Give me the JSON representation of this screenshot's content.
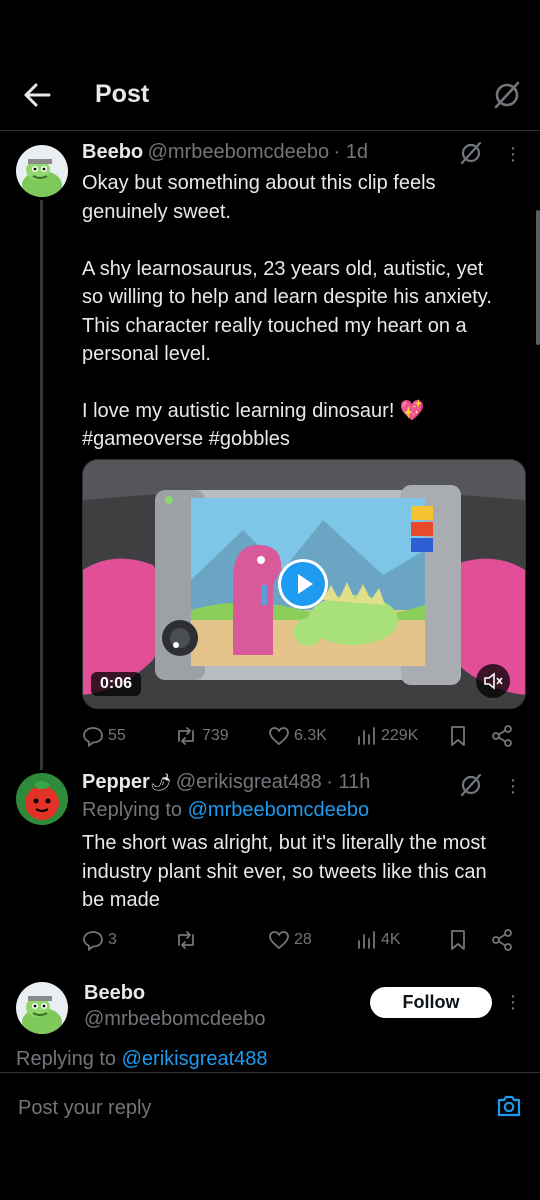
{
  "header": {
    "title": "Post"
  },
  "main_post": {
    "name": "Beebo",
    "handle": "@mrbeebomcdeebo",
    "time": "· 1d",
    "body": "Okay but something about this clip feels\ngenuinely sweet.\n\nA shy learnosaurus, 23 years old, autistic, yet\nso willing to help and learn despite his anxiety.\nThis character really touched my heart on a\npersonal level.\n\nI love my autistic learning dinosaur! 💖",
    "hashtags": "#gameoverse #gobbles",
    "video_time": "0:06",
    "stats": {
      "replies": "55",
      "reposts": "739",
      "likes": "6.3K",
      "views": "229K"
    }
  },
  "reply_post": {
    "name": "Pepper",
    "name_emoji": "🌶",
    "handle": "@erikisgreat488",
    "time": "· 11h",
    "replying_prefix": "Replying to ",
    "replying_to": "@mrbeebomcdeebo",
    "body": "The short was alright, but it's literally the most\nindustry plant shit ever, so tweets like this can\nbe made",
    "stats": {
      "replies": "3",
      "reposts": "",
      "likes": "28",
      "views": "4K"
    }
  },
  "bottom_post": {
    "name": "Beebo",
    "handle": "@mrbeebomcdeebo",
    "follow_label": "Follow",
    "replying_prefix": "Replying to ",
    "replying_to": "@erikisgreat488"
  },
  "reply_input": {
    "placeholder": "Post your reply"
  },
  "colors": {
    "accent": "#1d9bf0",
    "muted": "#71767b",
    "background": "#000000"
  }
}
